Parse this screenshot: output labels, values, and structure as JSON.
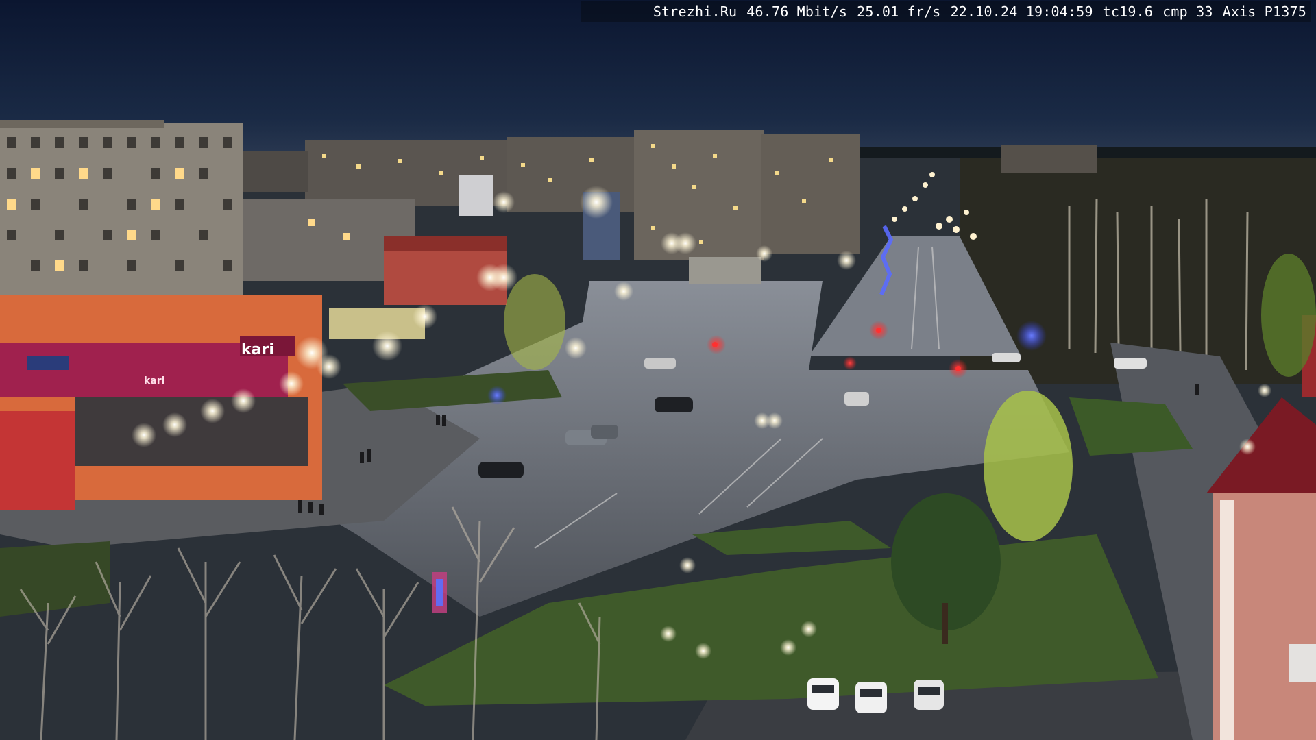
{
  "overlay": {
    "site": "Strezhi.Ru",
    "bitrate": "46.76 Mbit/s",
    "framerate": "25.01 fr/s",
    "datetime": "22.10.24 19:04:59",
    "tc": "tc19.6",
    "cmp": "cmp 33",
    "camera": "Axis P1375"
  },
  "signs": {
    "store": "kari",
    "store_small": "kari"
  },
  "colors": {
    "sky_top": "#0b1630",
    "sky_horizon": "#23324a",
    "asphalt": "#5c6068",
    "grass": "#3f5a2a",
    "lamp": "#fff8dc",
    "traffic_red": "#ff2a2a",
    "store_facade": "#d86a3c",
    "store_sign": "#a0214e"
  }
}
